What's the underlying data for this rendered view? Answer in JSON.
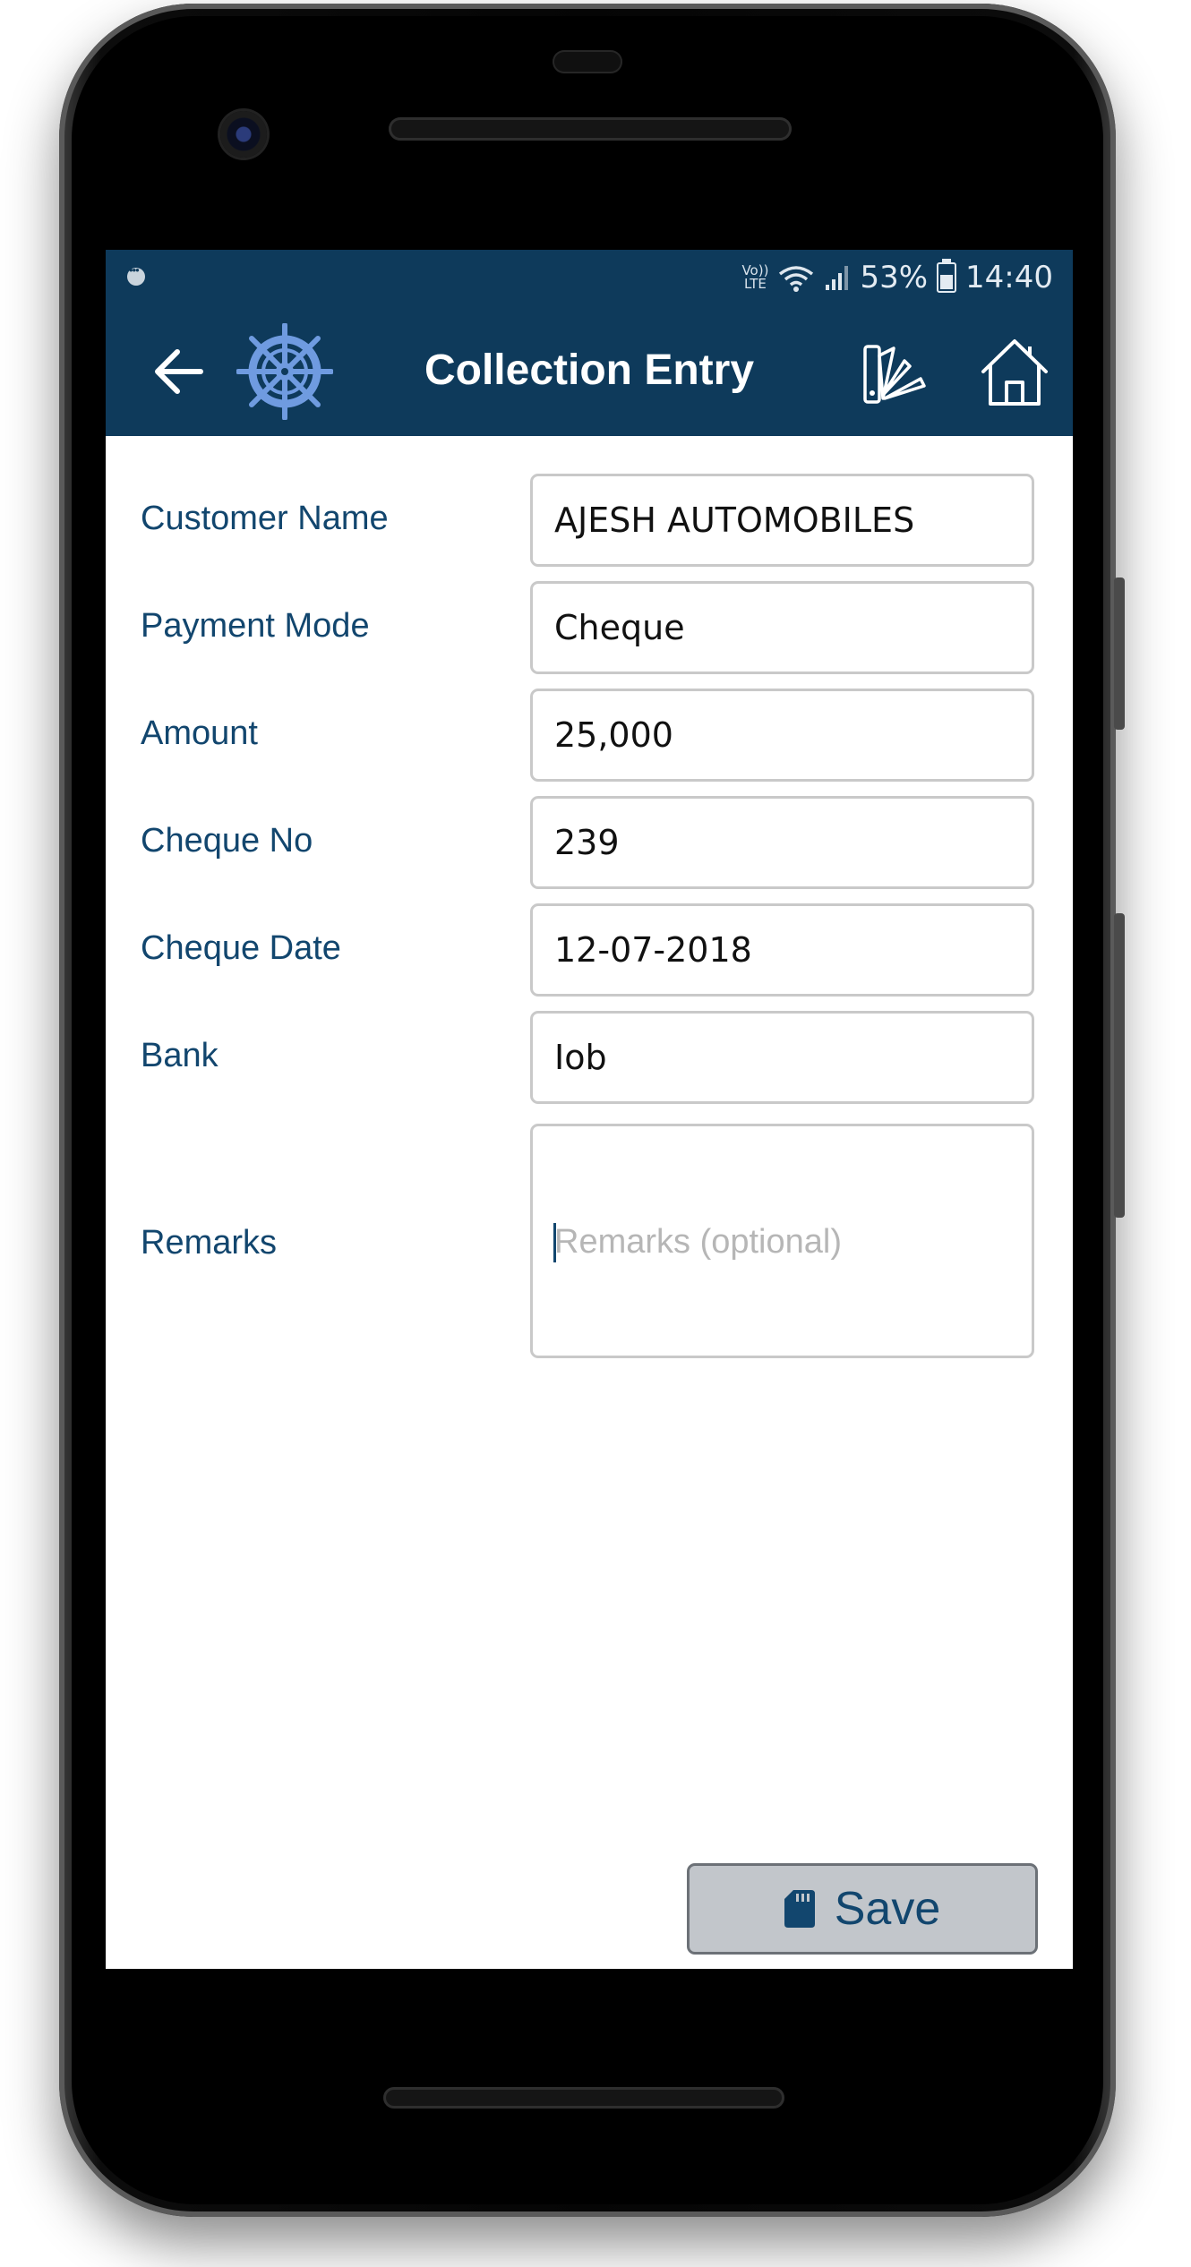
{
  "status_bar": {
    "volte_top": "Vo))",
    "volte_bottom": "LTE",
    "battery": "53%",
    "time": "14:40"
  },
  "app_bar": {
    "title": "Collection Entry",
    "icons": [
      "arrow-left-icon",
      "ship-wheel-icon",
      "color-palette-icon",
      "home-icon"
    ]
  },
  "form": {
    "customer_name": {
      "label": "Customer Name",
      "value": "AJESH AUTOMOBILES"
    },
    "payment_mode": {
      "label": "Payment Mode",
      "value": "Cheque"
    },
    "amount": {
      "label": "Amount",
      "value": "25,000"
    },
    "cheque_no": {
      "label": "Cheque No",
      "value": "239"
    },
    "cheque_date": {
      "label": "Cheque Date",
      "value": "12-07-2018"
    },
    "bank": {
      "label": "Bank",
      "value": "Iob"
    },
    "remarks": {
      "label": "Remarks",
      "value": "",
      "placeholder": "Remarks (optional)"
    }
  },
  "actions": {
    "save_label": "Save"
  },
  "colors": {
    "header": "#0e3a5b",
    "label_text": "#12466e",
    "logo_blue": "#6f9be0",
    "save_button_bg": "#c2c6cb"
  }
}
